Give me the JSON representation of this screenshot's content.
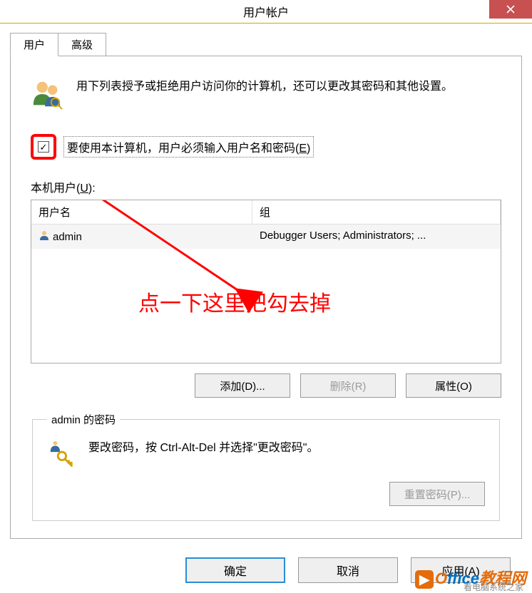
{
  "title": "用户帐户",
  "tabs": {
    "users": "用户",
    "advanced": "高级"
  },
  "intro": "用下列表授予或拒绝用户访问你的计算机，还可以更改其密码和其他设置。",
  "checkbox_label_pre": "要使用本计算机，用户必须输入用户名和密码(",
  "checkbox_label_key": "E",
  "checkbox_label_post": ")",
  "section_label_pre": "本机用户(",
  "section_label_key": "U",
  "section_label_post": "):",
  "columns": {
    "name": "用户名",
    "group": "组"
  },
  "rows": [
    {
      "name": "admin",
      "group": "Debugger Users; Administrators; ..."
    }
  ],
  "annotation": "点一下这里把勾去掉",
  "buttons": {
    "add": "添加(D)...",
    "remove": "删除(R)",
    "properties": "属性(O)",
    "reset_pw": "重置密码(P)...",
    "ok": "确定",
    "cancel": "取消",
    "apply": "应用(A)"
  },
  "pw_legend": "admin 的密码",
  "pw_text": "要改密码，按 Ctrl-Alt-Del 并选择\"更改密码\"。",
  "watermark": {
    "brand1": "O",
    "brand2": "ffice",
    "brand3": "教程网",
    "sub": "看电脑系统之家"
  }
}
